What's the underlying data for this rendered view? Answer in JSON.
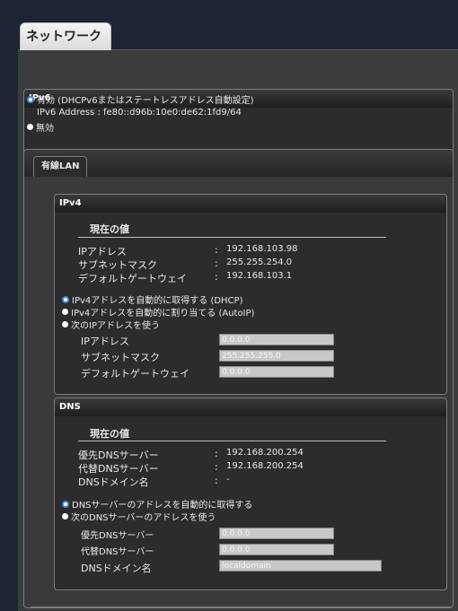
{
  "page": {
    "title": "ネットワーク"
  },
  "ipv6": {
    "header": "IPv6",
    "enabled_label": "有効 (DHCPv6またはステートレスアドレス自動設定)",
    "address_line": "IPv6 Address : fe80::d96b:10e0:de62:1fd9/64",
    "disabled_label": "無効"
  },
  "wired": {
    "tab_label": "有線LAN",
    "ipv4": {
      "header": "IPv4",
      "current_title": "現在の値",
      "rows": [
        {
          "label": "IPアドレス",
          "sep": ":",
          "value": "192.168.103.98"
        },
        {
          "label": "サブネットマスク",
          "sep": ":",
          "value": "255.255.254.0"
        },
        {
          "label": "デフォルトゲートウェイ",
          "sep": ":",
          "value": "192.168.103.1"
        }
      ],
      "options": [
        "IPv4アドレスを自動的に取得する (DHCP)",
        "IPv4アドレスを自動的に割り当てる (AutoIP)",
        "次のIPアドレスを使う"
      ],
      "fields": [
        {
          "label": "IPアドレス",
          "value": "0.0.0.0"
        },
        {
          "label": "サブネットマスク",
          "value": "255.255.255.0"
        },
        {
          "label": "デフォルトゲートウェイ",
          "value": "0.0.0.0"
        }
      ]
    },
    "dns": {
      "header": "DNS",
      "current_title": "現在の値",
      "rows": [
        {
          "label": "優先DNSサーバー",
          "sep": ":",
          "value": "192.168.200.254"
        },
        {
          "label": "代替DNSサーバー",
          "sep": ":",
          "value": "192.168.200.254"
        },
        {
          "label": "DNSドメイン名",
          "sep": ":",
          "value": "-"
        }
      ],
      "options": [
        "DNSサーバーのアドレスを自動的に取得する",
        "次のDNSサーバーのアドレスを使う"
      ],
      "fields": [
        {
          "label": "優先DNSサーバー",
          "value": "0.0.0.0"
        },
        {
          "label": "代替DNSサーバー",
          "value": "0.0.0.0"
        },
        {
          "label": "DNSドメイン名",
          "value": "localdomain"
        }
      ]
    }
  },
  "colors": {
    "accent": "#3b8ce2",
    "background": "#1c2436",
    "panel": "#2c2c2c"
  }
}
